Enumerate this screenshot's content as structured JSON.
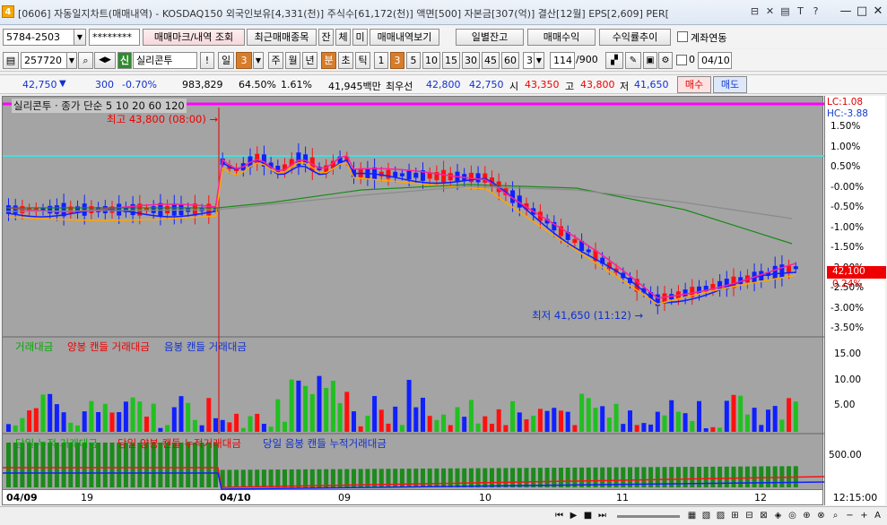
{
  "window": {
    "number": "4",
    "title": "[0606] 자동일지차트(매매내역) - KOSDAQ150 외국인보유[4,331(천)] 주식수[61,172(천)] 액면[500] 자본금[307(억)] 결산[12월] EPS[2,609] PER[",
    "tb_icons": [
      "⊟",
      "✕",
      "▤",
      "T",
      "?"
    ],
    "ctrls": [
      "—",
      "□",
      "✕"
    ]
  },
  "toolbar1": {
    "account": "5784-2503",
    "password": "********",
    "buttons": [
      "매매마크/내역 조회",
      "최근매매종목",
      "잔",
      "체",
      "미",
      "매매내역보기"
    ],
    "right_buttons": [
      "일별잔고",
      "매매수익",
      "수익률추이"
    ],
    "linked_label": "계좌연동"
  },
  "toolbar2": {
    "code": "257720",
    "stock_badge": "신",
    "stock_name": "실리콘투",
    "excl": "!",
    "period_sel": "일",
    "period_num": "3",
    "periods": [
      "주",
      "월",
      "년",
      "분",
      "초",
      "틱"
    ],
    "intervals": [
      "1",
      "3",
      "5",
      "10",
      "15",
      "30",
      "45",
      "60"
    ],
    "interval_num": "3",
    "count": "114",
    "count_total": "/900",
    "check_val": "0",
    "date": "04/10"
  },
  "quote": {
    "price": "42,750",
    "arrow": "▼",
    "change": "300",
    "change_pct": "-0.70%",
    "volume": "983,829",
    "ratio": "64.50%",
    "turnover": "1.61%",
    "value": "41,945백만",
    "best_label": "최우선",
    "ask": "42,800",
    "bid": "42,750",
    "open_label": "시",
    "open": "43,350",
    "high_label": "고",
    "high": "43,800",
    "low_label": "저",
    "low": "41,650",
    "buy": "매수",
    "sell": "매도"
  },
  "chart": {
    "legend": "실리콘투 · 종가 단순 5 10 20 60 120",
    "lc": "LC:1.08",
    "hc": "HC:-3.88",
    "high_note": "최고 43,800 (08:00) →",
    "low_note": "최저 41,650 (11:12) →",
    "current_price": "42,100",
    "current_pct": "0.24%",
    "y_labels": [
      "1.50%",
      "1.00%",
      "0.50%",
      "-0.00%",
      "-0.50%",
      "-1.00%",
      "-1.50%",
      "-2.00%",
      "-2.50%",
      "-3.00%",
      "-3.50%"
    ],
    "vol_title": "거래대금",
    "vol_up": "양봉 캔들 거래대금",
    "vol_down": "음봉 캔들 거래대금",
    "vol_labels": [
      "15.00",
      "10.00",
      "5.00"
    ],
    "cum_title": "당일 누적 거래대금",
    "cum_up": "당일 양봉 캔들 누적거래대금",
    "cum_down": "당일 음봉 캔들 누적거래대금",
    "cum_labels": [
      "500.00"
    ],
    "x_labels": [
      "04/09",
      "19",
      "04/10",
      "09",
      "10",
      "11",
      "12"
    ],
    "time": "12:15:00"
  },
  "chart_data": {
    "type": "candlestick",
    "symbol": "실리콘투",
    "interval": "3분",
    "last_price": 42100,
    "high": 43800,
    "low": 41650
  }
}
